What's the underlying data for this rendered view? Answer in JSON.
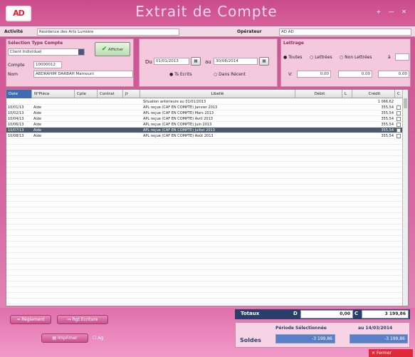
{
  "app": {
    "logo": "AD",
    "title": "Extrait de Compte",
    "window_controls": "+ — ✕"
  },
  "info": {
    "activite_label": "Activité",
    "activite_value": "Résidence des Arts Lumière",
    "operateur_label": "Opérateur",
    "operateur_value": "AD AD"
  },
  "selection": {
    "title": "Sélection Type Compte",
    "type_value": "Client Individuel",
    "compte_label": "Compte",
    "compte_value": "10000012",
    "nom_label": "Nom",
    "nom_value": "ABDRAHIM DARBAH Mamouni",
    "afficher_label": "Afficher"
  },
  "dates": {
    "du_label": "Du",
    "du_value": "01/01/2013",
    "au_label": "au",
    "au_value": "30/08/2014",
    "radio_ts": "Ts Ecrits",
    "radio_recent": "Dans Récent"
  },
  "lettrage": {
    "title": "Lettrage",
    "options": [
      "Toutes",
      "Lettrées",
      "Non Lettrées",
      "à"
    ],
    "v_label": "V:",
    "v1": "0,00",
    "v2": "0,00",
    "v3": "0,00"
  },
  "table": {
    "columns": [
      "Date",
      "N°Pièce",
      "Cpte",
      "Contrat",
      "Jr",
      "Libellé",
      "Débit",
      "L",
      "Crédit",
      "C"
    ],
    "rows": [
      {
        "date": "",
        "piece": "",
        "libelle": "Situation antérieure au 01/01/2013",
        "debit": "",
        "credit": "1 066,62",
        "selected": false
      },
      {
        "date": "10/01/13",
        "piece": "Aide",
        "libelle": "APL reçue (CAF EN COMPTE) Janvier 2013",
        "debit": "",
        "credit": "355,54",
        "selected": false
      },
      {
        "date": "10/02/13",
        "piece": "Aide",
        "libelle": "APL reçue (CAF EN COMPTE) Mars 2013",
        "debit": "",
        "credit": "355,54",
        "selected": false
      },
      {
        "date": "10/04/13",
        "piece": "Aide",
        "libelle": "APL reçue (CAF EN COMPTE) Avril 2013",
        "debit": "",
        "credit": "355,54",
        "selected": false
      },
      {
        "date": "10/06/13",
        "piece": "Aide",
        "libelle": "APL reçue (CAF EN COMPTE) Juin 2013",
        "debit": "",
        "credit": "355,54",
        "selected": false
      },
      {
        "date": "10/07/13",
        "piece": "Aide",
        "libelle": "APL reçue (CAF EN COMPTE) Juillet 2013",
        "debit": "",
        "credit": "355,54",
        "selected": true
      },
      {
        "date": "10/08/13",
        "piece": "Aide",
        "libelle": "APL reçue (CAF EN COMPTE) Août 2013",
        "debit": "",
        "credit": "355,54",
        "selected": false
      }
    ]
  },
  "footer": {
    "reglement": "Règlement",
    "reglement_ecrit": "Rgt Ecriture",
    "imprimer": "Imprimer",
    "ag": "Ag",
    "totaux_label": "Totaux",
    "d_label": "D",
    "d_value": "0,00",
    "c_label": "C",
    "c_value": "3 199,86",
    "periode_label": "Période Sélectionnée",
    "au_date": "au 14/03/2014",
    "soldes_label": "Soldes",
    "solde1": "-3 199,86",
    "solde2": "-3 199,86",
    "fermer": "Fermer"
  }
}
